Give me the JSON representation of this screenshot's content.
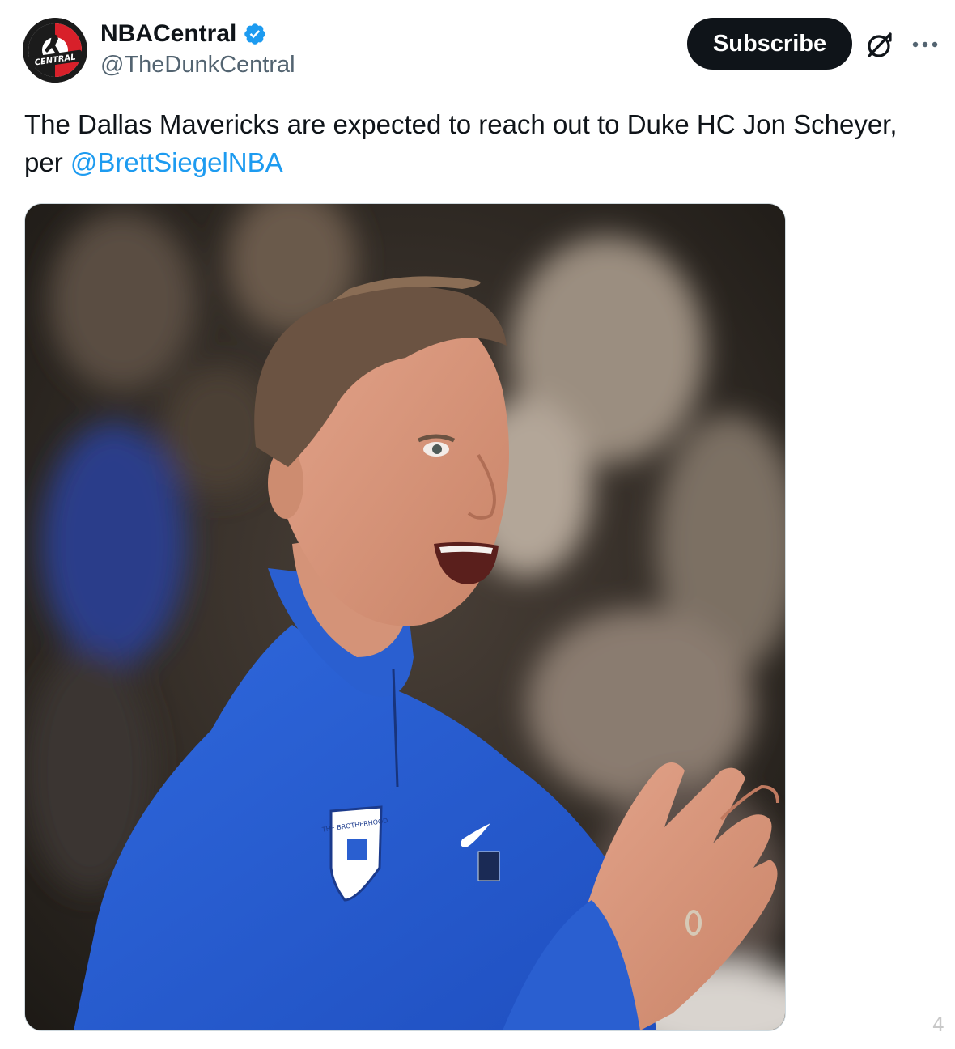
{
  "account": {
    "display_name": "NBACentral",
    "handle": "@TheDunkCentral",
    "verified": true,
    "avatar_text": "CENTRAL"
  },
  "actions": {
    "subscribe_label": "Subscribe",
    "grok_icon": "grok-icon",
    "more_icon": "more-icon"
  },
  "tweet": {
    "text": "The Dallas Mavericks are expected to reach out to Duke HC Jon Scheyer, per ",
    "mention": "@BrettSiegelNBA"
  },
  "media": {
    "type": "photo",
    "badge_text": "THE BROTHERHOOD"
  },
  "watermark": {
    "text": "4"
  },
  "colors": {
    "accent": "#1d9bf0",
    "button_bg": "#0f1419",
    "secondary_text": "#536471",
    "jacket_blue": "#2b5fd1"
  }
}
